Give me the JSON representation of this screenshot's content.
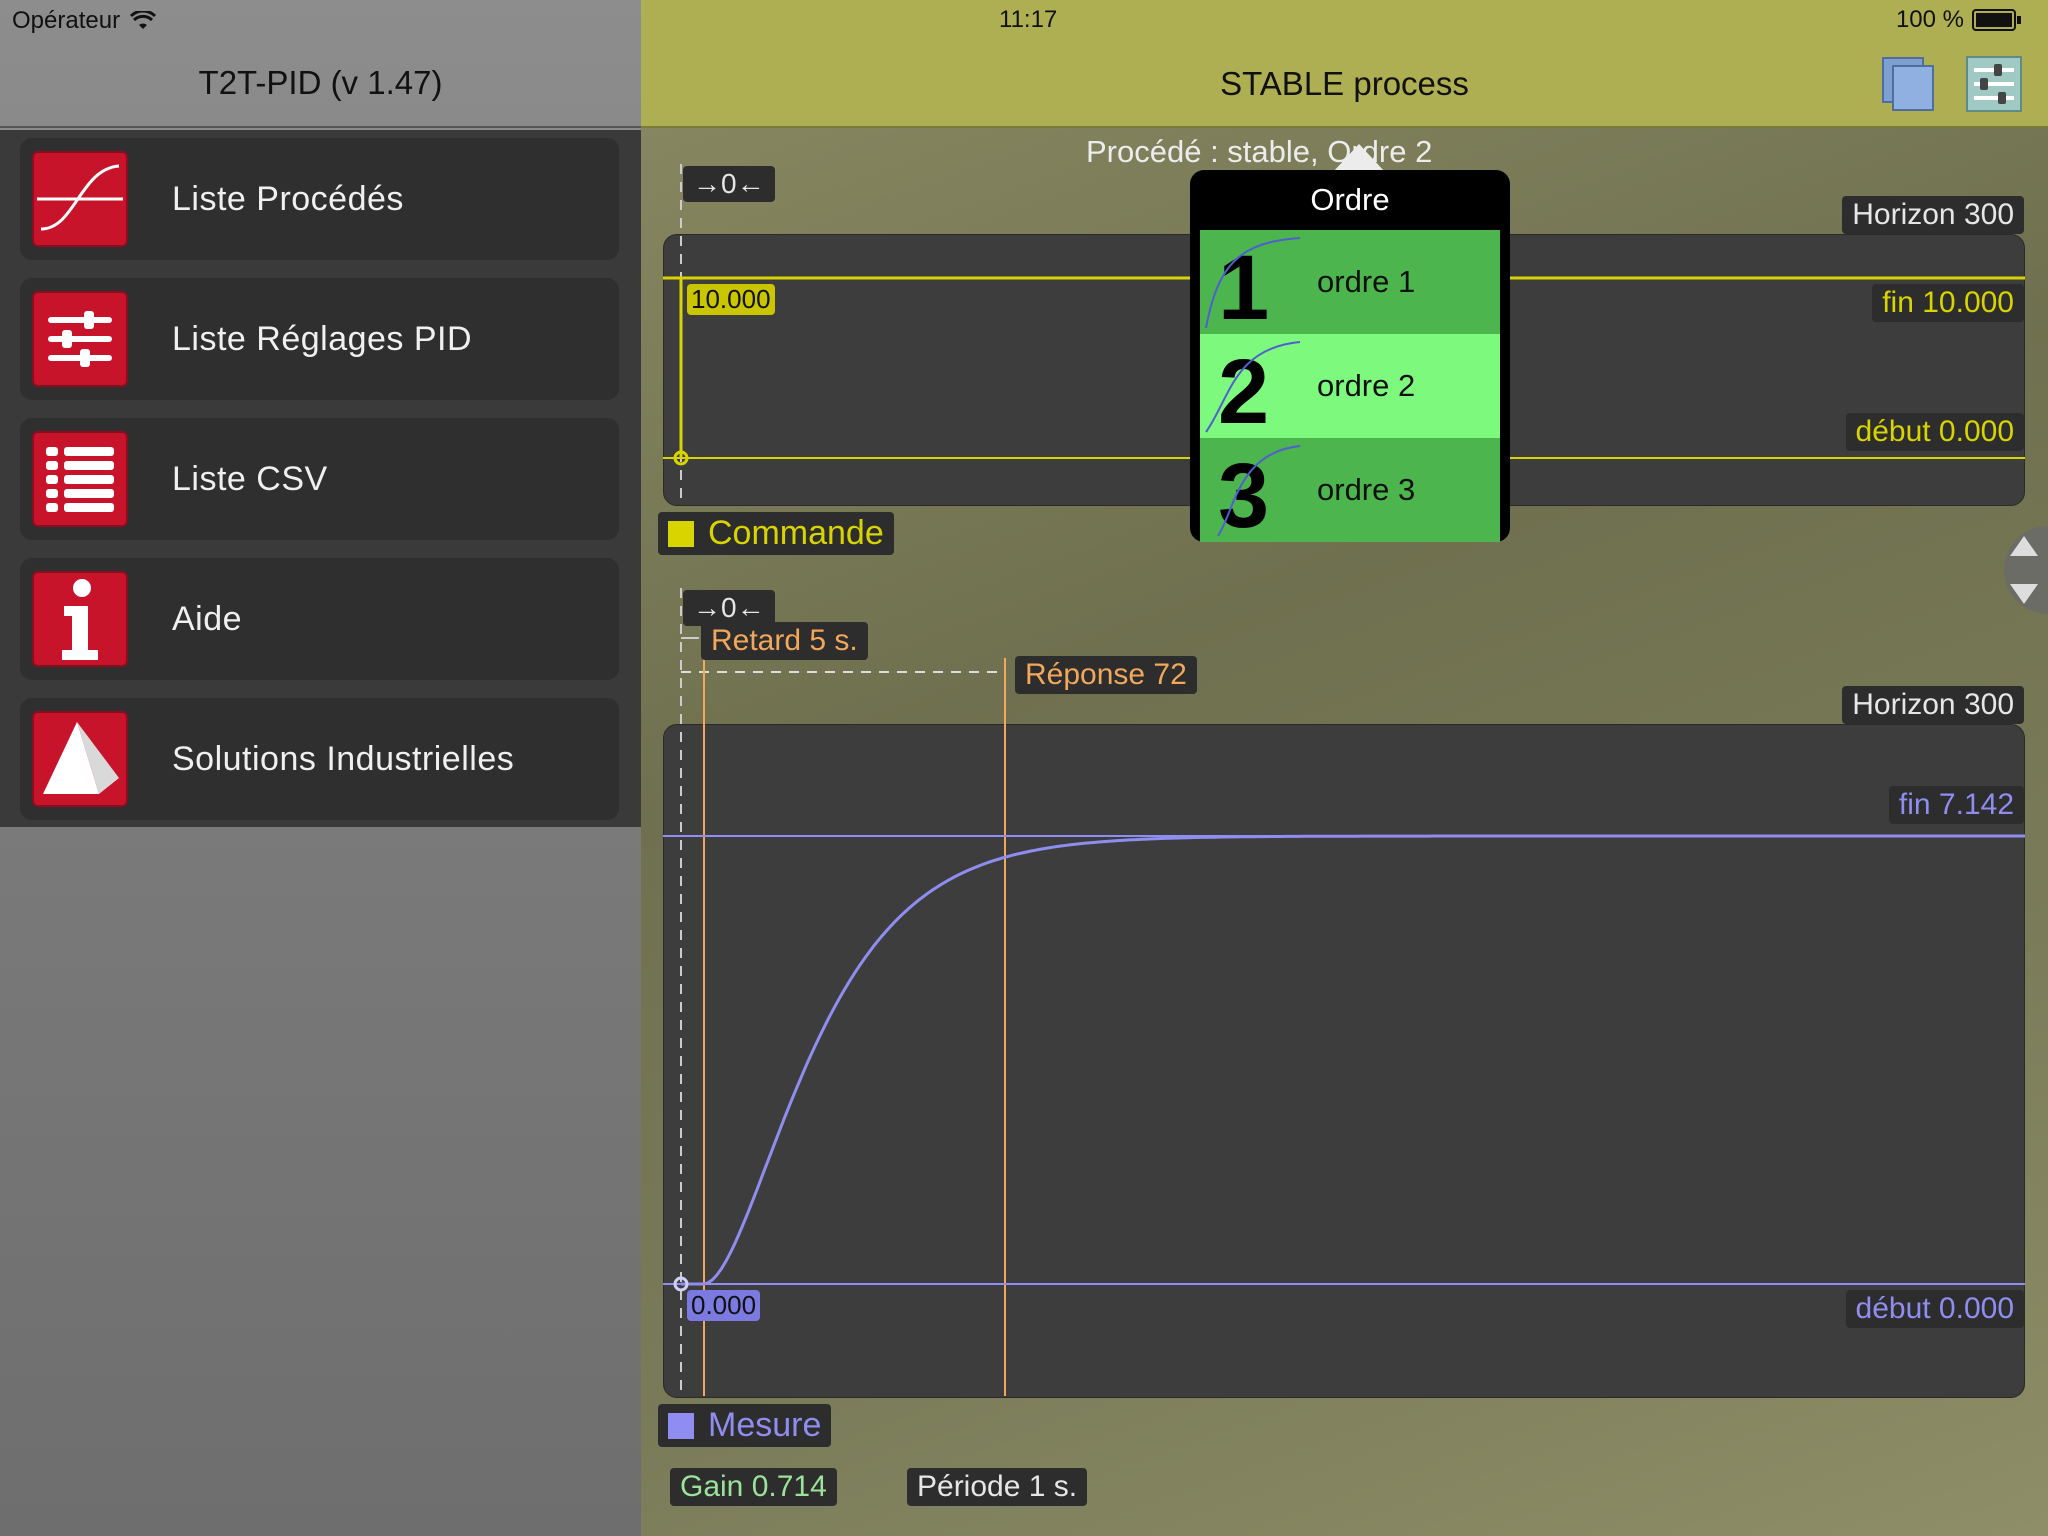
{
  "status_bar": {
    "carrier": "Opérateur",
    "time": "11:17",
    "battery": "100 %"
  },
  "sidebar": {
    "title": "T2T-PID (v 1.47)",
    "items": [
      {
        "label": "Liste Procédés",
        "icon": "curve-icon"
      },
      {
        "label": "Liste Réglages PID",
        "icon": "sliders-icon"
      },
      {
        "label": "Liste CSV",
        "icon": "list-icon"
      },
      {
        "label": "Aide",
        "icon": "info-icon"
      },
      {
        "label": "Solutions Industrielles",
        "icon": "pyramid-icon"
      }
    ]
  },
  "header": {
    "title": "STABLE process"
  },
  "subtitle": "Procédé : stable, Ordre 2",
  "command_chart": {
    "zero_marker": "→0←",
    "horizon": "Horizon 300",
    "fin": "fin 10.000",
    "debut": "début 0.000",
    "value_label": "10.000",
    "legend": "Commande",
    "color": "#d7d400"
  },
  "measure_chart": {
    "zero_marker": "→0←",
    "retard": "Retard 5 s.",
    "reponse": "Réponse 72",
    "horizon": "Horizon 300",
    "fin": "fin 7.142",
    "debut": "début 0.000",
    "value_label": "0.000",
    "legend": "Mesure",
    "color": "#8f8ef0"
  },
  "footer": {
    "gain": "Gain 0.714",
    "periode": "Période 1 s."
  },
  "popup": {
    "title": "Ordre",
    "options": [
      {
        "number": "1",
        "label": "ordre 1",
        "color": "#4db54d"
      },
      {
        "number": "2",
        "label": "ordre 2",
        "color": "#7dfa7d",
        "selected": true
      },
      {
        "number": "3",
        "label": "ordre 3",
        "color": "#4db54d"
      }
    ]
  },
  "chart_data": [
    {
      "type": "line",
      "series": [
        {
          "name": "Commande",
          "x": [
            0,
            0,
            300
          ],
          "y": [
            0,
            10,
            10
          ]
        }
      ],
      "ylim": [
        0,
        10
      ],
      "xlim": [
        0,
        300
      ]
    },
    {
      "type": "line",
      "series": [
        {
          "name": "Mesure",
          "x": [
            0,
            5,
            20,
            35,
            50,
            72,
            100,
            150,
            300
          ],
          "y": [
            0,
            0,
            1.8,
            4.5,
            6.0,
            6.9,
            7.1,
            7.14,
            7.142
          ]
        }
      ],
      "ylim": [
        0,
        7.142
      ],
      "xlim": [
        0,
        300
      ]
    }
  ]
}
